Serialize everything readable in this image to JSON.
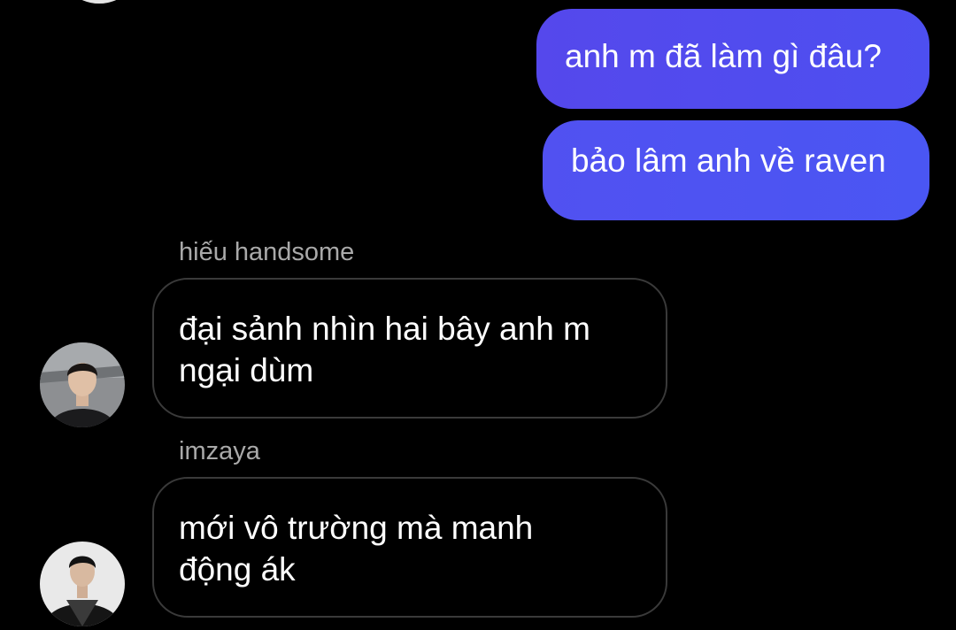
{
  "chat": {
    "outgoing": [
      {
        "text": "anh m đã làm gì đâu?"
      },
      {
        "text": "bảo lâm anh về raven"
      }
    ],
    "incoming": [
      {
        "sender": "hiếu handsome",
        "lines": [
          "đại sảnh nhìn hai bây anh m",
          "ngại dùm"
        ]
      },
      {
        "sender": "imzaya",
        "lines": [
          "mới vô trường mà manh",
          "động ák"
        ]
      }
    ]
  },
  "colors": {
    "background": "#000000",
    "outgoing_bubble": "#4d4ff0",
    "incoming_bubble_border": "#3a3a3a",
    "sender_name": "#a9a9a9",
    "text": "#ffffff"
  }
}
